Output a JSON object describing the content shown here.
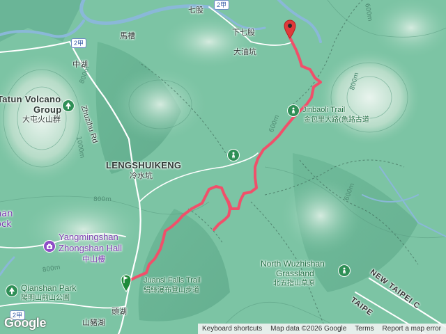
{
  "labels": {
    "qigu": "七股",
    "macao": "馬槽",
    "xiaqigu": "下七股",
    "dayoukeng": "大油坑",
    "zhonghu": "中湖",
    "tatun_en": "Tatun Volcano",
    "tatun_group": "Group",
    "tatun_zh": "大屯火山群",
    "zhuzihu_rd": "Zhuzihu Rd",
    "lengshuikeng_en": "LENGSHUIKENG",
    "lengshuikeng_zh": "冷水坑",
    "jinbaoli_en": "Jinbaoli Trail",
    "jinbaoli_zh": "金包里大路(魚路古道",
    "yangmingshan_en1": "Yangmingshan",
    "yangmingshan_en2": "Zhongshan Hall",
    "yangmingshan_zh": "中山樓",
    "qianshan_en": "Qianshan Park",
    "qianshan_zh": "陽明山前山公園",
    "juansi_en": "Juansi Falls Trail",
    "juansi_zh": "絹絲瀑布登山步道",
    "wuzhishan_en1": "North Wuzhishan",
    "wuzhishan_en2": "Grassland",
    "wuzhishan_zh": "北五指山草原",
    "touhu": "頭湖",
    "shanzhuhu": "山豬湖",
    "new_taipei": "NEW TAIPEI C",
    "taipei": "TAIPE",
    "left_partial_1": "nan",
    "left_partial_2": "ock",
    "contour_600_a": "600m",
    "contour_600_b": "600m",
    "contour_600_c": "600m",
    "contour_800_a": "800m",
    "contour_800_b": "800m",
    "contour_800_c": "800m",
    "contour_800_d": "800m",
    "contour_1000": "1000m"
  },
  "shields": {
    "top": "2甲",
    "left": "2甲",
    "bottom_left": "2甲"
  },
  "attribution": {
    "shortcuts": "Keyboard shortcuts",
    "map_data": "Map data ©2026 Google",
    "terms": "Terms",
    "report": "Report a map error"
  },
  "logo": "Google",
  "icons": {
    "start": "green-flag-marker-icon",
    "end": "red-destination-pin-icon",
    "park": "park-icon",
    "museum": "camera-icon"
  },
  "colors": {
    "terrain": "#7cc4a4",
    "route": "#f0506a",
    "poi_green": "#2f8f56",
    "poi_purple": "#8e4ec6",
    "water": "#8ab8d8"
  }
}
